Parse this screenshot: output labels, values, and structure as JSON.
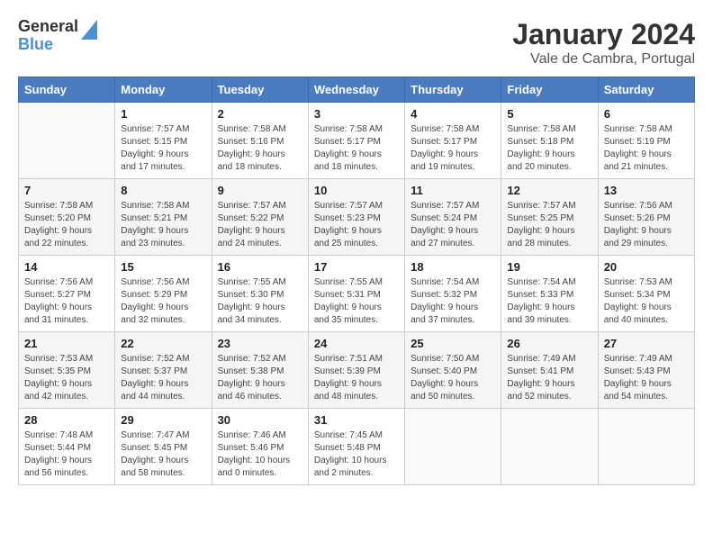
{
  "header": {
    "logo_general": "General",
    "logo_blue": "Blue",
    "title": "January 2024",
    "subtitle": "Vale de Cambra, Portugal"
  },
  "days_of_week": [
    "Sunday",
    "Monday",
    "Tuesday",
    "Wednesday",
    "Thursday",
    "Friday",
    "Saturday"
  ],
  "weeks": [
    [
      {
        "day": "",
        "empty": true
      },
      {
        "day": "1",
        "sunrise": "7:57 AM",
        "sunset": "5:15 PM",
        "daylight": "9 hours and 17 minutes."
      },
      {
        "day": "2",
        "sunrise": "7:58 AM",
        "sunset": "5:16 PM",
        "daylight": "9 hours and 18 minutes."
      },
      {
        "day": "3",
        "sunrise": "7:58 AM",
        "sunset": "5:17 PM",
        "daylight": "9 hours and 18 minutes."
      },
      {
        "day": "4",
        "sunrise": "7:58 AM",
        "sunset": "5:17 PM",
        "daylight": "9 hours and 19 minutes."
      },
      {
        "day": "5",
        "sunrise": "7:58 AM",
        "sunset": "5:18 PM",
        "daylight": "9 hours and 20 minutes."
      },
      {
        "day": "6",
        "sunrise": "7:58 AM",
        "sunset": "5:19 PM",
        "daylight": "9 hours and 21 minutes."
      }
    ],
    [
      {
        "day": "7",
        "sunrise": "7:58 AM",
        "sunset": "5:20 PM",
        "daylight": "9 hours and 22 minutes."
      },
      {
        "day": "8",
        "sunrise": "7:58 AM",
        "sunset": "5:21 PM",
        "daylight": "9 hours and 23 minutes."
      },
      {
        "day": "9",
        "sunrise": "7:57 AM",
        "sunset": "5:22 PM",
        "daylight": "9 hours and 24 minutes."
      },
      {
        "day": "10",
        "sunrise": "7:57 AM",
        "sunset": "5:23 PM",
        "daylight": "9 hours and 25 minutes."
      },
      {
        "day": "11",
        "sunrise": "7:57 AM",
        "sunset": "5:24 PM",
        "daylight": "9 hours and 27 minutes."
      },
      {
        "day": "12",
        "sunrise": "7:57 AM",
        "sunset": "5:25 PM",
        "daylight": "9 hours and 28 minutes."
      },
      {
        "day": "13",
        "sunrise": "7:56 AM",
        "sunset": "5:26 PM",
        "daylight": "9 hours and 29 minutes."
      }
    ],
    [
      {
        "day": "14",
        "sunrise": "7:56 AM",
        "sunset": "5:27 PM",
        "daylight": "9 hours and 31 minutes."
      },
      {
        "day": "15",
        "sunrise": "7:56 AM",
        "sunset": "5:29 PM",
        "daylight": "9 hours and 32 minutes."
      },
      {
        "day": "16",
        "sunrise": "7:55 AM",
        "sunset": "5:30 PM",
        "daylight": "9 hours and 34 minutes."
      },
      {
        "day": "17",
        "sunrise": "7:55 AM",
        "sunset": "5:31 PM",
        "daylight": "9 hours and 35 minutes."
      },
      {
        "day": "18",
        "sunrise": "7:54 AM",
        "sunset": "5:32 PM",
        "daylight": "9 hours and 37 minutes."
      },
      {
        "day": "19",
        "sunrise": "7:54 AM",
        "sunset": "5:33 PM",
        "daylight": "9 hours and 39 minutes."
      },
      {
        "day": "20",
        "sunrise": "7:53 AM",
        "sunset": "5:34 PM",
        "daylight": "9 hours and 40 minutes."
      }
    ],
    [
      {
        "day": "21",
        "sunrise": "7:53 AM",
        "sunset": "5:35 PM",
        "daylight": "9 hours and 42 minutes."
      },
      {
        "day": "22",
        "sunrise": "7:52 AM",
        "sunset": "5:37 PM",
        "daylight": "9 hours and 44 minutes."
      },
      {
        "day": "23",
        "sunrise": "7:52 AM",
        "sunset": "5:38 PM",
        "daylight": "9 hours and 46 minutes."
      },
      {
        "day": "24",
        "sunrise": "7:51 AM",
        "sunset": "5:39 PM",
        "daylight": "9 hours and 48 minutes."
      },
      {
        "day": "25",
        "sunrise": "7:50 AM",
        "sunset": "5:40 PM",
        "daylight": "9 hours and 50 minutes."
      },
      {
        "day": "26",
        "sunrise": "7:49 AM",
        "sunset": "5:41 PM",
        "daylight": "9 hours and 52 minutes."
      },
      {
        "day": "27",
        "sunrise": "7:49 AM",
        "sunset": "5:43 PM",
        "daylight": "9 hours and 54 minutes."
      }
    ],
    [
      {
        "day": "28",
        "sunrise": "7:48 AM",
        "sunset": "5:44 PM",
        "daylight": "9 hours and 56 minutes."
      },
      {
        "day": "29",
        "sunrise": "7:47 AM",
        "sunset": "5:45 PM",
        "daylight": "9 hours and 58 minutes."
      },
      {
        "day": "30",
        "sunrise": "7:46 AM",
        "sunset": "5:46 PM",
        "daylight": "10 hours and 0 minutes."
      },
      {
        "day": "31",
        "sunrise": "7:45 AM",
        "sunset": "5:48 PM",
        "daylight": "10 hours and 2 minutes."
      },
      {
        "day": "",
        "empty": true
      },
      {
        "day": "",
        "empty": true
      },
      {
        "day": "",
        "empty": true
      }
    ]
  ],
  "labels": {
    "sunrise_prefix": "Sunrise: ",
    "sunset_prefix": "Sunset: ",
    "daylight_prefix": "Daylight: "
  }
}
